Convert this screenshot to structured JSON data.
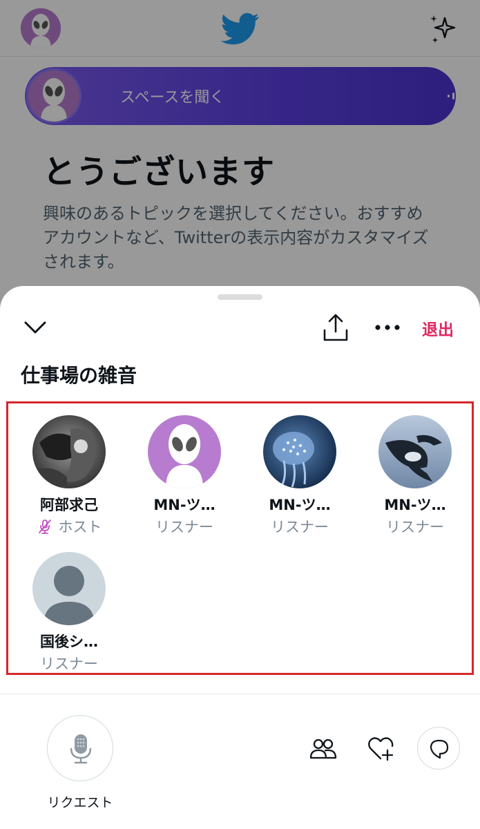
{
  "background": {
    "banner": {
      "label": "スペースを聞く"
    },
    "welcome": {
      "title": "とうございます",
      "text": "興味のあるトピックを選択してください。おすすめアカウントなど、Twitterの表示内容がカスタマイズされます。"
    }
  },
  "sheet": {
    "leave_label": "退出",
    "space_title": "仕事場の雑音",
    "participants": [
      {
        "name": "阿部求己",
        "role": "ホスト",
        "muted": true
      },
      {
        "name": "MN-ツ…",
        "role": "リスナー"
      },
      {
        "name": "MN-ツ…",
        "role": "リスナー"
      },
      {
        "name": "MN-ツ…",
        "role": "リスナー"
      },
      {
        "name": "国後シ…",
        "role": "リスナー"
      }
    ],
    "request_label": "リクエスト"
  },
  "colors": {
    "accent": "#1d9bf0",
    "leave": "#e0245e",
    "banner_start": "#7a5cf0",
    "banner_end": "#4c33d0",
    "highlight_border": "#d6262b",
    "avatar_purple": "#b77ccf"
  }
}
